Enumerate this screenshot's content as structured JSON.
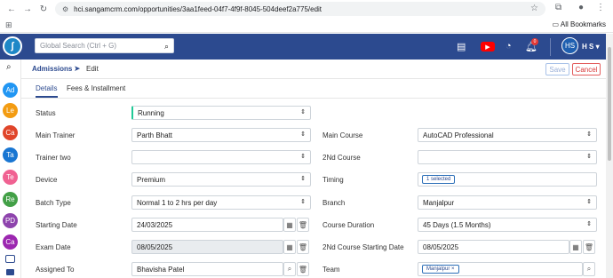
{
  "browser": {
    "url": "hci.sangamcrm.com/opportunities/3aa1feed-04f7-4f9f-8045-504deef2a775/edit",
    "all_bookmarks": "All Bookmarks"
  },
  "header": {
    "search_placeholder": "Global Search (Ctrl + G)",
    "notification_count": "0",
    "avatar_initials": "HS",
    "user_name": "H S"
  },
  "sidebar": {
    "items": [
      {
        "label": "Ad",
        "color": "#2196f3"
      },
      {
        "label": "Le",
        "color": "#f39c12"
      },
      {
        "label": "Ca",
        "color": "#e0452a"
      },
      {
        "label": "Ta",
        "color": "#1976d2"
      },
      {
        "label": "Te",
        "color": "#f06292"
      },
      {
        "label": "Re",
        "color": "#43a047"
      },
      {
        "label": "PD",
        "color": "#8e44ad"
      },
      {
        "label": "Ca",
        "color": "#9c27b0"
      }
    ]
  },
  "breadcrumb": {
    "module": "Admissions",
    "current": "Edit"
  },
  "actions": {
    "save": "Save",
    "cancel": "Cancel"
  },
  "tabs": [
    {
      "label": "Details"
    },
    {
      "label": "Fees & Installment"
    }
  ],
  "form": {
    "status": {
      "label": "Status",
      "value": "Running"
    },
    "main_trainer": {
      "label": "Main Trainer",
      "value": "Parth Bhatt"
    },
    "main_course": {
      "label": "Main Course",
      "value": "AutoCAD Professional"
    },
    "trainer_two": {
      "label": "Trainer two",
      "value": ""
    },
    "second_course": {
      "label": "2Nd Course",
      "value": ""
    },
    "device": {
      "label": "Device",
      "value": "Premium"
    },
    "timing": {
      "label": "Timing",
      "value": "1 selected"
    },
    "batch_type": {
      "label": "Batch Type",
      "value": "Normal 1 to 2 hrs per day"
    },
    "branch": {
      "label": "Branch",
      "value": "Manjalpur"
    },
    "starting_date": {
      "label": "Starting Date",
      "value": "24/03/2025"
    },
    "course_duration": {
      "label": "Course Duration",
      "value": "45 Days (1.5 Months)"
    },
    "exam_date": {
      "label": "Exam Date",
      "value": "08/05/2025"
    },
    "second_course_start": {
      "label": "2Nd Course Starting Date",
      "value": "08/05/2025"
    },
    "assigned_to": {
      "label": "Assigned To",
      "value": "Bhavisha Patel"
    },
    "team": {
      "label": "Team",
      "value": "Manjalpur"
    }
  }
}
